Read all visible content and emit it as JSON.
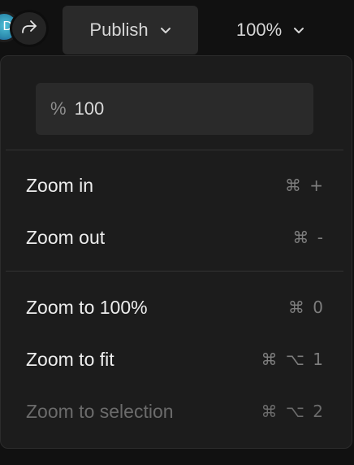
{
  "toolbar": {
    "avatar_initial": "D",
    "share_icon": "share-arrow-icon",
    "publish_label": "Publish",
    "zoom_label": "100%"
  },
  "zoom_menu": {
    "input": {
      "prefix": "%",
      "value": "100"
    },
    "items": [
      {
        "label": "Zoom in",
        "shortcut": "⌘ +",
        "enabled": true
      },
      {
        "label": "Zoom out",
        "shortcut": "⌘ -",
        "enabled": true
      },
      {
        "label": "Zoom to 100%",
        "shortcut": "⌘ 0",
        "enabled": true
      },
      {
        "label": "Zoom to fit",
        "shortcut": "⌘ ⌥ 1",
        "enabled": true
      },
      {
        "label": "Zoom to selection",
        "shortcut": "⌘ ⌥ 2",
        "enabled": false
      }
    ]
  },
  "colors": {
    "background": "#111111",
    "menu_background": "#1c1c1c",
    "button_background": "#2a2a2a",
    "text": "#ededed",
    "muted_text": "#7d7d7d",
    "disabled_text": "#6b6b6b"
  }
}
